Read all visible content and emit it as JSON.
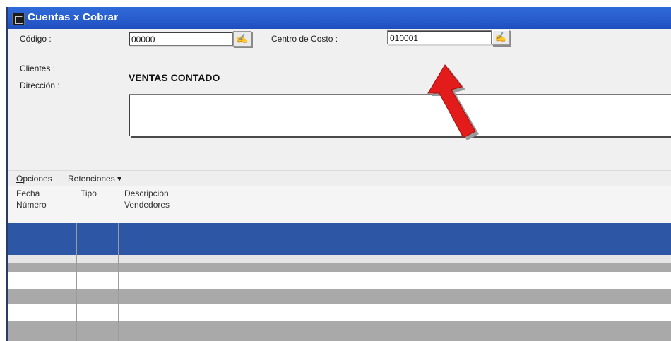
{
  "window": {
    "title": "Cuentas x Cobrar"
  },
  "form": {
    "codigo_label": "Código :",
    "codigo_value": "00000",
    "centro_label": "Centro de Costo :",
    "centro_value": "010001",
    "clientes_label": "Clientes :",
    "clientes_value": "VENTAS CONTADO",
    "direccion_label": "Dirección :",
    "direccion_value": ""
  },
  "menubar": {
    "opciones": "Opciones",
    "retenciones": "Retenciones ▾"
  },
  "grid": {
    "headers": [
      {
        "line1": "Fecha",
        "line2": "Número"
      },
      {
        "line1": "Tipo",
        "line2": ""
      },
      {
        "line1": "Descripción",
        "line2": "Vendedores"
      }
    ],
    "colors": {
      "selected": "#2d56a4",
      "gray": "#a9a9a9",
      "white": "#ffffff"
    }
  },
  "annotation": {
    "arrow_color": "#e31b1b"
  }
}
